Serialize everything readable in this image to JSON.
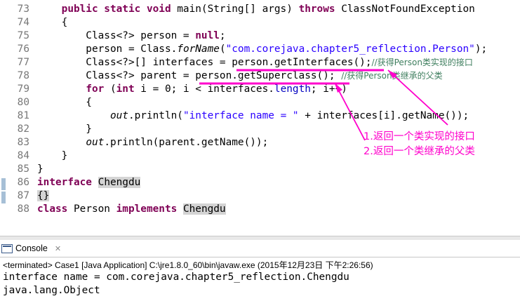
{
  "editor": {
    "lines": [
      {
        "num": "73",
        "parts": [
          [
            "    ",
            ""
          ],
          [
            "public static void",
            "kw"
          ],
          [
            " main(String[] args) ",
            ""
          ],
          [
            "throws",
            "kw"
          ],
          [
            " ClassNotFoundException",
            ""
          ]
        ]
      },
      {
        "num": "74",
        "parts": [
          [
            "    {",
            ""
          ]
        ]
      },
      {
        "num": "75",
        "parts": [
          [
            "        Class<?> person = ",
            ""
          ],
          [
            "null",
            "kw"
          ],
          [
            ";",
            ""
          ]
        ]
      },
      {
        "num": "76",
        "parts": [
          [
            "        person = Class.",
            ""
          ],
          [
            "forName",
            "st"
          ],
          [
            "(",
            ""
          ],
          [
            "\"com.corejava.chapter5_reflection.Person\"",
            "str"
          ],
          [
            ");",
            ""
          ]
        ]
      },
      {
        "num": "77",
        "parts": [
          [
            "        Class<?>[] interfaces = person.getInterfaces();",
            ""
          ],
          [
            "//获得Person类实现的接口",
            "cm"
          ]
        ]
      },
      {
        "num": "78",
        "parts": [
          [
            "        Class<?> parent = person.getSuperclass(); ",
            ""
          ],
          [
            "//获得Person类继承的父类",
            "cm"
          ]
        ]
      },
      {
        "num": "79",
        "parts": [
          [
            "        ",
            ""
          ],
          [
            "for",
            "kw"
          ],
          [
            " (",
            ""
          ],
          [
            "int",
            "kw"
          ],
          [
            " i = 0; i < interfaces.",
            ""
          ],
          [
            "length",
            "fld"
          ],
          [
            "; i++)",
            ""
          ]
        ]
      },
      {
        "num": "80",
        "parts": [
          [
            "        {",
            ""
          ]
        ]
      },
      {
        "num": "81",
        "parts": [
          [
            "            ",
            ""
          ],
          [
            "out",
            "st"
          ],
          [
            ".println(",
            ""
          ],
          [
            "\"interface name = \"",
            "str"
          ],
          [
            " + interfaces[i].getName());",
            ""
          ]
        ]
      },
      {
        "num": "82",
        "parts": [
          [
            "        }",
            ""
          ]
        ]
      },
      {
        "num": "83",
        "parts": [
          [
            "        ",
            ""
          ],
          [
            "out",
            "st"
          ],
          [
            ".println(parent.getName());",
            ""
          ]
        ]
      },
      {
        "num": "84",
        "parts": [
          [
            "    }",
            ""
          ]
        ]
      },
      {
        "num": "85",
        "parts": [
          [
            "}",
            ""
          ]
        ]
      },
      {
        "num": "86",
        "parts": [
          [
            "interface",
            "kw"
          ],
          [
            " ",
            ""
          ],
          [
            "Chengdu",
            "hl"
          ]
        ]
      },
      {
        "num": "87",
        "parts": [
          [
            "{}",
            "hl"
          ]
        ]
      },
      {
        "num": "88",
        "parts": [
          [
            "class",
            "kw"
          ],
          [
            " Person ",
            ""
          ],
          [
            "implements",
            "kw"
          ],
          [
            " ",
            ""
          ],
          [
            "Chengdu",
            "hl"
          ]
        ]
      }
    ]
  },
  "annotations": {
    "note1": "1.返回一个类实现的接口",
    "note2": "2.返回一个类继承的父类",
    "color": "#ff00cc"
  },
  "console": {
    "tab_label": "Console",
    "close_glyph": "✕",
    "status": "<terminated> Case1 [Java Application] C:\\jre1.8.0_60\\bin\\javaw.exe (2015年12月23日 下午2:26:56)",
    "output": [
      "interface name = com.corejava.chapter5_reflection.Chengdu",
      "java.lang.Object"
    ]
  }
}
